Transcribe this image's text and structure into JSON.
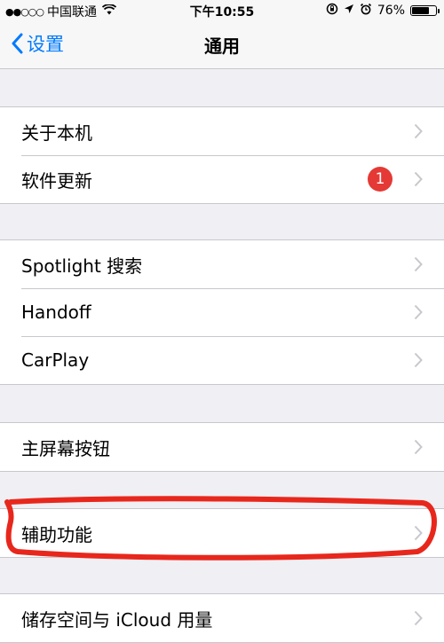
{
  "status_bar": {
    "signal_dots": "●●○○○",
    "carrier": "中国联通",
    "time": "下午10:55",
    "battery": "76%",
    "battery_level": 0.76
  },
  "nav": {
    "back_label": "设置",
    "title": "通用"
  },
  "groups": [
    {
      "items": [
        {
          "label": "关于本机"
        },
        {
          "label": "软件更新",
          "badge": "1"
        }
      ]
    },
    {
      "items": [
        {
          "label": "Spotlight 搜索"
        },
        {
          "label": "Handoff"
        },
        {
          "label": "CarPlay"
        }
      ]
    },
    {
      "items": [
        {
          "label": "主屏幕按钮"
        }
      ]
    },
    {
      "items": [
        {
          "label": "辅助功能"
        }
      ]
    },
    {
      "items": [
        {
          "label": "储存空间与 iCloud 用量"
        }
      ]
    }
  ],
  "colors": {
    "accent": "#007aff",
    "badge": "#e53935",
    "annotation": "#e8271c"
  }
}
